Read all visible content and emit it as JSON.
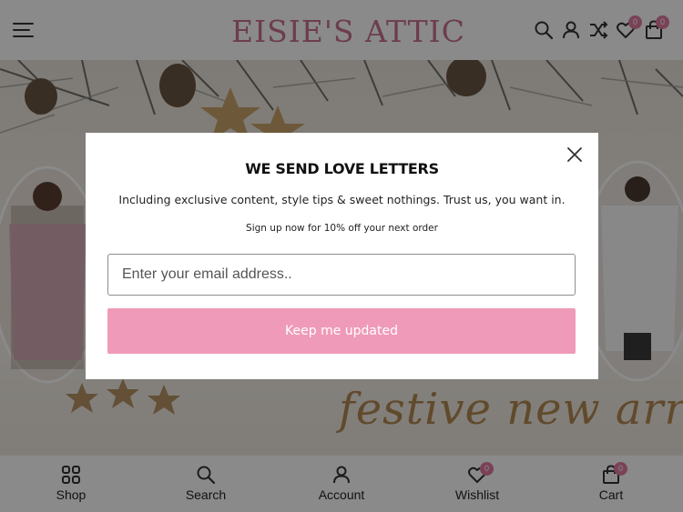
{
  "header": {
    "logo_text": "EISIE'S ATTIC",
    "icons": [
      "menu-icon",
      "search-icon",
      "account-icon",
      "compare-icon",
      "wishlist-icon",
      "cart-icon"
    ],
    "wishlist_count": "0",
    "cart_count": "0"
  },
  "hero": {
    "caption": "festive new arrivals"
  },
  "popup": {
    "title": "WE SEND LOVE LETTERS",
    "subtitle": "Including exclusive content, style tips & sweet nothings. Trust us, you want in.",
    "note": "Sign up now for 10% off your next order",
    "email_placeholder": "Enter your email address..",
    "email_value": "",
    "button_label": "Keep me updated"
  },
  "bottom_nav": {
    "items": [
      {
        "label": "Shop",
        "icon": "grid-icon"
      },
      {
        "label": "Search",
        "icon": "search-icon"
      },
      {
        "label": "Account",
        "icon": "account-icon"
      },
      {
        "label": "Wishlist",
        "icon": "wishlist-icon",
        "badge": "0"
      },
      {
        "label": "Cart",
        "icon": "cart-icon",
        "badge": "0"
      }
    ]
  },
  "colors": {
    "brand_pink": "#c9728f",
    "button_pink": "#ef9ab8",
    "badge_pink": "#e07aa0",
    "caption_gold": "#b48a52"
  }
}
